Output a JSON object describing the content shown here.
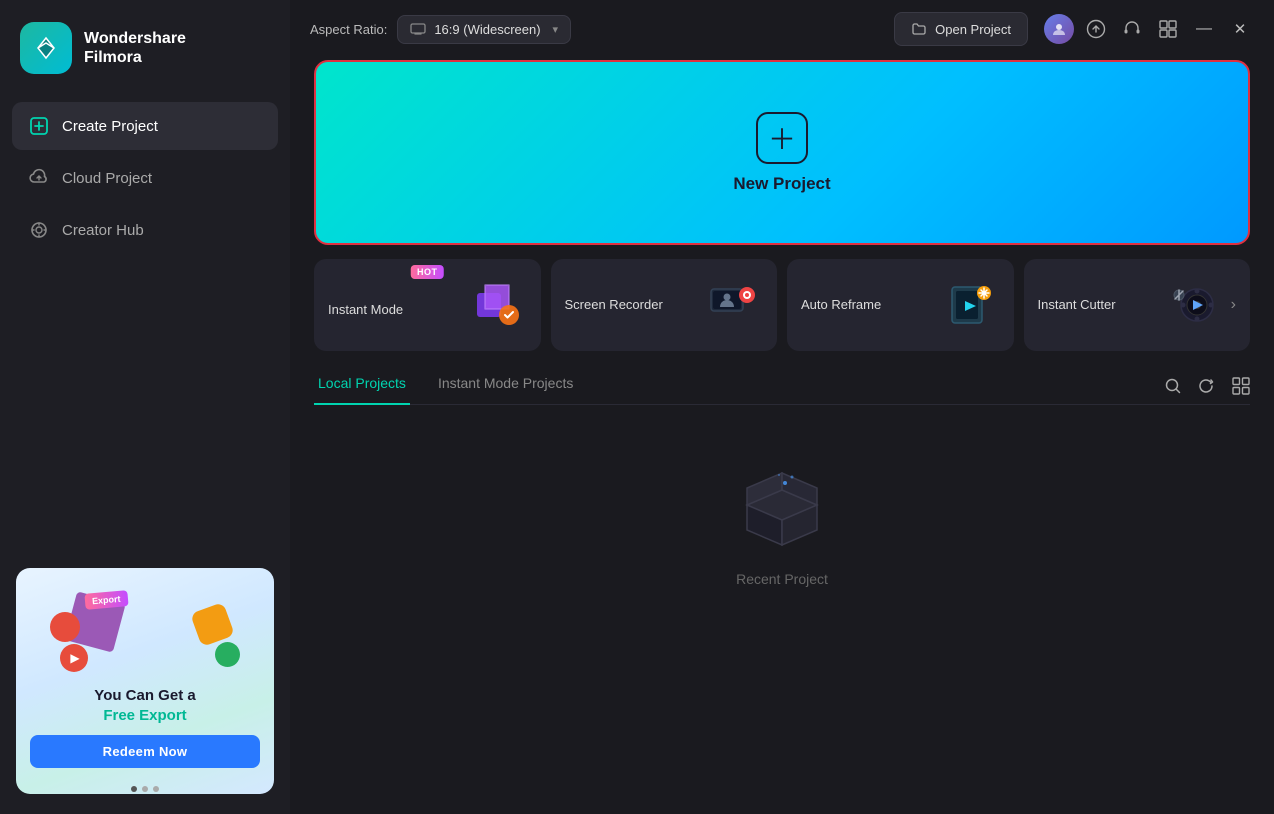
{
  "app": {
    "name": "Wondershare",
    "name2": "Filmora"
  },
  "window_controls": {
    "minimize_label": "—",
    "close_label": "✕"
  },
  "topbar": {
    "aspect_label": "Aspect Ratio:",
    "aspect_value": "16:9 (Widescreen)",
    "open_project_label": "Open Project"
  },
  "new_project": {
    "label": "New Project"
  },
  "quick_tools": [
    {
      "id": "instant-mode",
      "label": "Instant Mode",
      "hot": true
    },
    {
      "id": "screen-recorder",
      "label": "Screen Recorder",
      "hot": false
    },
    {
      "id": "auto-reframe",
      "label": "Auto Reframe",
      "hot": false
    },
    {
      "id": "instant-cutter",
      "label": "Instant Cutter",
      "hot": false
    }
  ],
  "hot_badge": "HOT",
  "projects": {
    "tabs": [
      {
        "id": "local",
        "label": "Local Projects",
        "active": true
      },
      {
        "id": "instant-mode",
        "label": "Instant Mode Projects",
        "active": false
      }
    ],
    "empty_label": "Recent Project"
  },
  "promo": {
    "export_tag": "Export",
    "line1": "You Can Get a",
    "line2": "Free Export",
    "cta": "Redeem Now"
  },
  "sidebar": {
    "items": [
      {
        "id": "create-project",
        "label": "Create Project",
        "active": true
      },
      {
        "id": "cloud-project",
        "label": "Cloud Project",
        "active": false
      },
      {
        "id": "creator-hub",
        "label": "Creator Hub",
        "active": false
      }
    ]
  },
  "colors": {
    "accent_green": "#00d4b0",
    "banner_border": "#e03040",
    "promo_btn": "#2979ff"
  }
}
